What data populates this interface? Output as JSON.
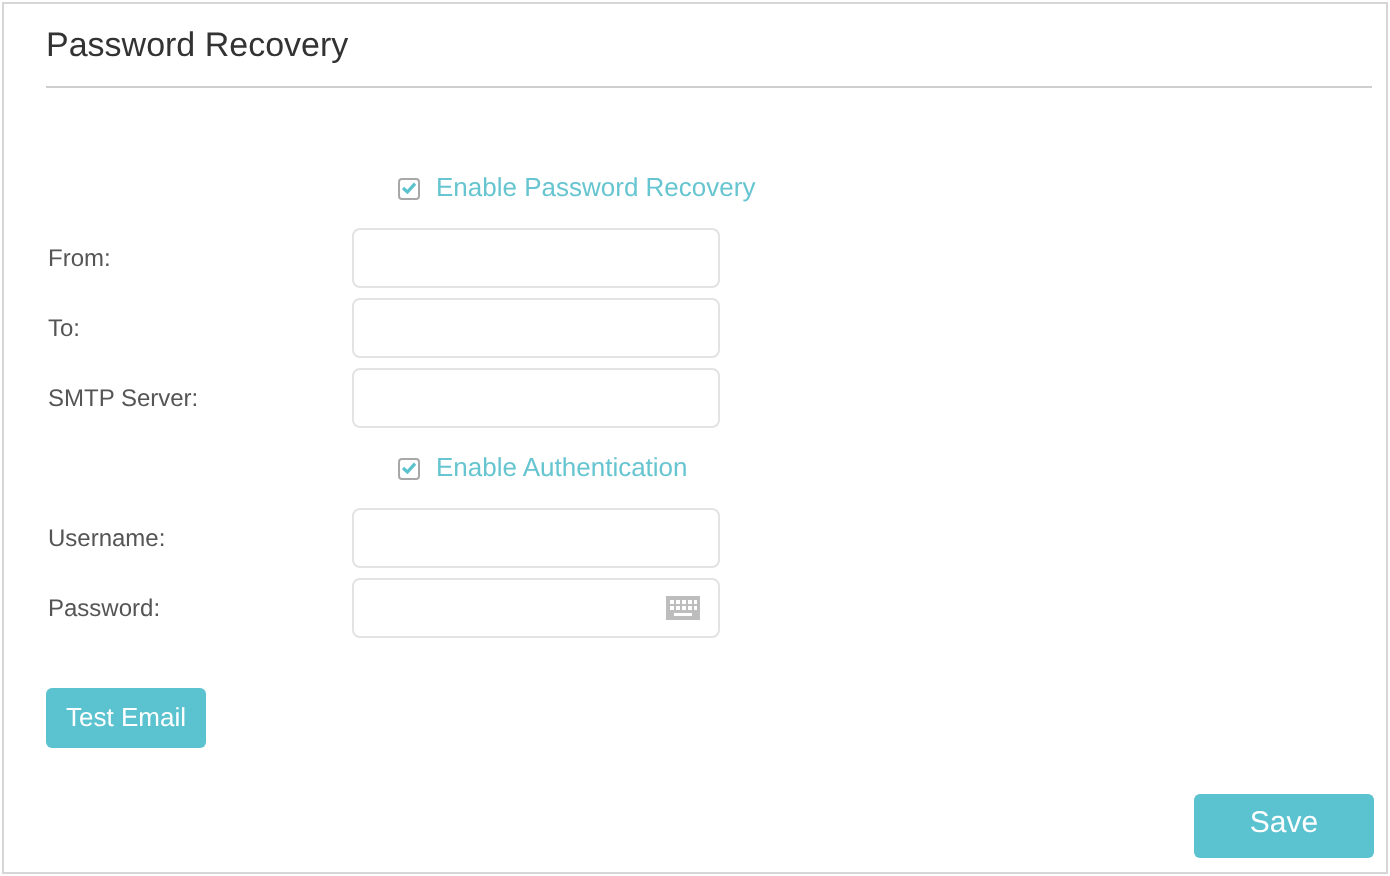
{
  "title": "Password Recovery",
  "rows": [
    {
      "kind": "checkbox",
      "label": "Enable Password Recovery",
      "checked": true
    },
    {
      "kind": "text",
      "label": "From:"
    },
    {
      "kind": "text",
      "label": "To:"
    },
    {
      "kind": "text",
      "label": "SMTP Server:"
    },
    {
      "kind": "checkbox",
      "label": "Enable Authentication",
      "checked": true
    },
    {
      "kind": "text",
      "label": "Username:"
    },
    {
      "kind": "password",
      "label": "Password:"
    }
  ],
  "test_button": "Test Email",
  "save_button": "Save"
}
